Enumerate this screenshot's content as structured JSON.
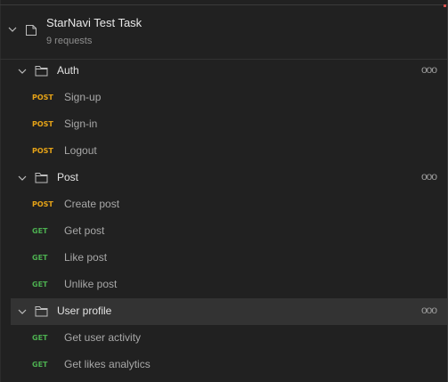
{
  "collection": {
    "name": "StarNavi Test Task",
    "count": "9 requests"
  },
  "folders": [
    {
      "name": "Auth",
      "requests": [
        {
          "method": "POST",
          "name": "Sign-up"
        },
        {
          "method": "POST",
          "name": "Sign-in"
        },
        {
          "method": "POST",
          "name": "Logout"
        }
      ]
    },
    {
      "name": "Post",
      "requests": [
        {
          "method": "POST",
          "name": "Create post"
        },
        {
          "method": "GET",
          "name": "Get post"
        },
        {
          "method": "GET",
          "name": "Like post"
        },
        {
          "method": "GET",
          "name": "Unlike post"
        }
      ]
    },
    {
      "name": "User profile",
      "selected": true,
      "requests": [
        {
          "method": "GET",
          "name": "Get user activity"
        },
        {
          "method": "GET",
          "name": "Get likes analytics"
        }
      ]
    }
  ],
  "more_label": "ooo",
  "colors": {
    "post": "#e6a317",
    "get": "#4caf50",
    "selected_row": "#333333"
  }
}
